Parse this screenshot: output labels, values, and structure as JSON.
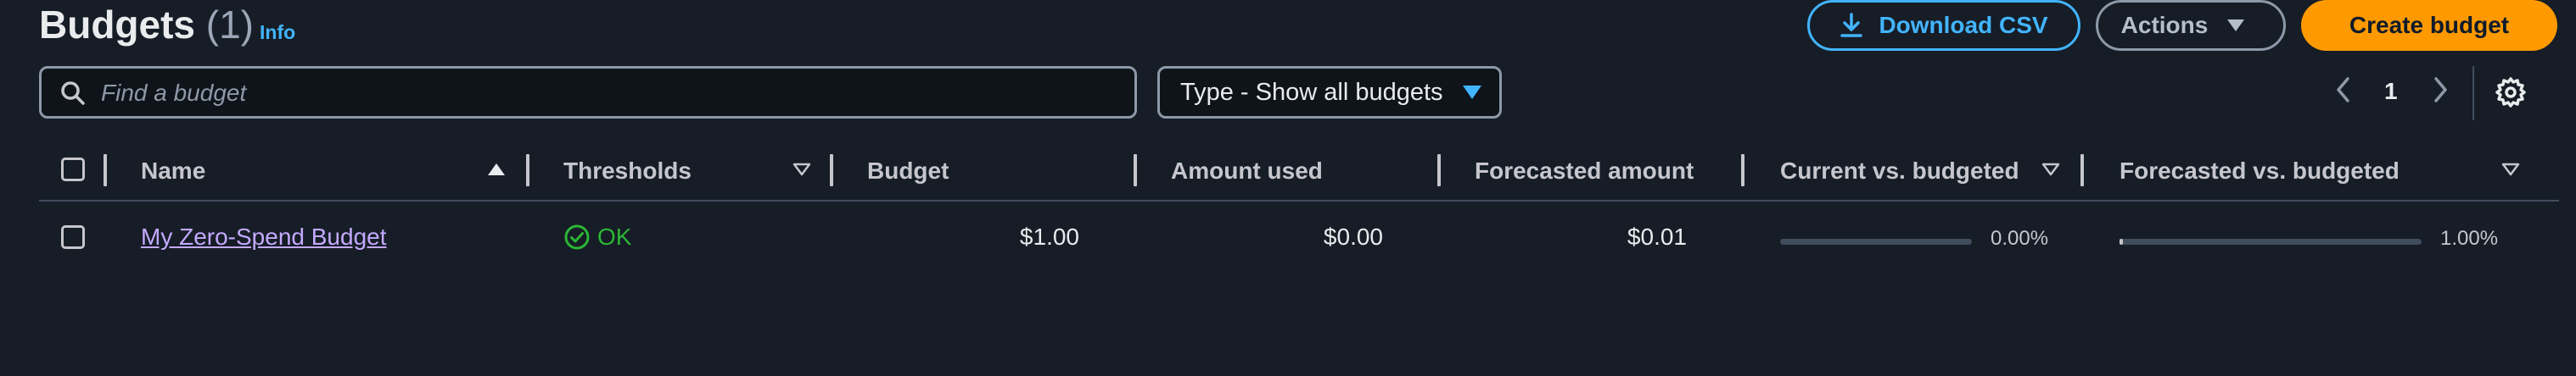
{
  "header": {
    "title": "Budgets",
    "count": "(1)",
    "info_label": "Info"
  },
  "toolbar": {
    "download_csv_label": "Download CSV",
    "actions_label": "Actions",
    "create_budget_label": "Create budget"
  },
  "filters": {
    "search_placeholder": "Find a budget",
    "search_value": "",
    "type_filter_label": "Type - Show all budgets"
  },
  "pagination": {
    "current_page": "1"
  },
  "table": {
    "columns": [
      {
        "label": "Name",
        "sort": "ascending"
      },
      {
        "label": "Thresholds",
        "sort": "sortable"
      },
      {
        "label": "Budget",
        "sort": "none"
      },
      {
        "label": "Amount used",
        "sort": "none"
      },
      {
        "label": "Forecasted amount",
        "sort": "none"
      },
      {
        "label": "Current vs. budgeted",
        "sort": "sortable"
      },
      {
        "label": "Forecasted vs. budgeted",
        "sort": "sortable"
      }
    ],
    "rows": [
      {
        "name": "My Zero-Spend Budget",
        "threshold_status": "OK",
        "budget": "$1.00",
        "amount_used": "$0.00",
        "forecasted_amount": "$0.01",
        "current_vs_budgeted_label": "0.00%",
        "current_vs_budgeted_pct": 0,
        "forecasted_vs_budgeted_label": "1.00%",
        "forecasted_vs_budgeted_pct": 1
      }
    ]
  },
  "colors": {
    "background": "#161d26",
    "primary_accent": "#ff9900",
    "link_blue": "#42b4ff",
    "name_link": "#c3a9ff",
    "status_ok": "#2bb534"
  },
  "icons": [
    "download-icon",
    "caret-down-icon",
    "search-icon",
    "chevron-left-icon",
    "chevron-right-icon",
    "settings-gear-icon",
    "sort-ascending-icon",
    "sort-icon",
    "check-circle-icon"
  ]
}
